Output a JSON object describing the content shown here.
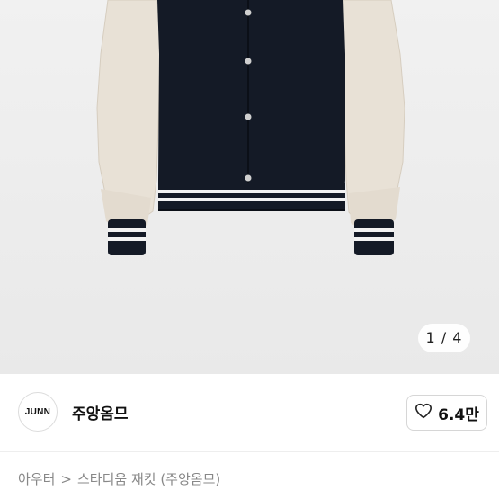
{
  "gallery": {
    "current_page": "1",
    "separator": "/",
    "total_pages": "4",
    "indicator_text": "1 / 4"
  },
  "seller": {
    "logo_text": "JUNN",
    "name": "주앙옴므"
  },
  "like": {
    "count": "6.4만",
    "icon": "heart-outline-icon"
  },
  "breadcrumb": {
    "category": "아우터",
    "separator": ">",
    "item": "스타디움 재킷 (주앙옴므)"
  },
  "colors": {
    "jacket_body": "#141a26",
    "sleeves": "#e8e1d6",
    "photo_background": "#ececec",
    "text_primary": "#111111",
    "text_secondary": "#888888"
  }
}
